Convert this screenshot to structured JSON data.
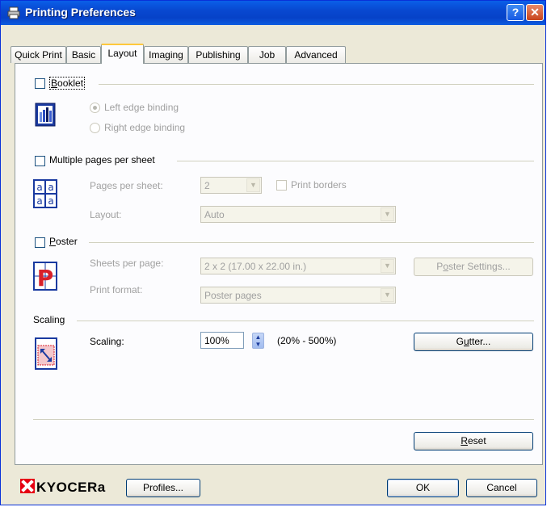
{
  "window": {
    "title": "Printing Preferences"
  },
  "titlebar_buttons": {
    "help": "?",
    "close": "✕"
  },
  "tabs": [
    {
      "label": "Quick Print"
    },
    {
      "label": "Basic"
    },
    {
      "label": "Layout",
      "active": true
    },
    {
      "label": "Imaging"
    },
    {
      "label": "Publishing"
    },
    {
      "label": "Job"
    },
    {
      "label": "Advanced"
    }
  ],
  "booklet": {
    "label": "Booklet",
    "checked": false,
    "options": [
      {
        "label": "Left edge binding",
        "selected": true
      },
      {
        "label": "Right edge binding",
        "selected": false
      }
    ]
  },
  "multiple_pages": {
    "label": "Multiple pages per sheet",
    "checked": false,
    "pages_label": "Pages per sheet:",
    "pages_value": "2",
    "print_borders_label": "Print borders",
    "layout_label": "Layout:",
    "layout_value": "Auto"
  },
  "poster": {
    "label": "Poster",
    "checked": false,
    "sheets_label": "Sheets per page:",
    "sheets_value": "2 x 2 (17.00 x 22.00 in.)",
    "format_label": "Print format:",
    "format_value": "Poster pages",
    "settings_button": "Poster Settings..."
  },
  "scaling": {
    "group_label": "Scaling",
    "label": "Scaling:",
    "value": "100%",
    "range": "(20% - 500%)",
    "gutter_button": "Gutter..."
  },
  "reset_button": "Reset",
  "footer": {
    "brand": "KYOCERa",
    "profiles_button": "Profiles...",
    "ok_button": "OK",
    "cancel_button": "Cancel"
  },
  "colors": {
    "title_blue": "#0848d0",
    "panel": "#fcfcfe",
    "dialog": "#ece9d8",
    "brand_red": "#e60012"
  }
}
